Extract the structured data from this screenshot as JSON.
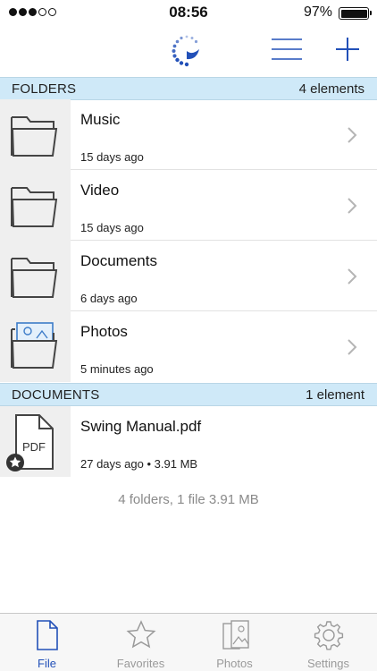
{
  "status_bar": {
    "time": "08:56",
    "battery_percent": "97%",
    "signal_bars_filled": 3,
    "signal_bars_total": 5
  },
  "navbar": {
    "logo_icon": "app-logo-icon",
    "menu_icon": "hamburger-menu-icon",
    "add_icon": "plus-icon",
    "accent_color": "#2250b8"
  },
  "folders_section": {
    "title": "FOLDERS",
    "count": "4 elements",
    "items": [
      {
        "name": "Music",
        "modified": "15 days ago",
        "icon": "folder-icon"
      },
      {
        "name": "Video",
        "modified": "15 days ago",
        "icon": "folder-icon"
      },
      {
        "name": "Documents",
        "modified": "6 days ago",
        "icon": "folder-icon"
      },
      {
        "name": "Photos",
        "modified": "5 minutes ago",
        "icon": "photos-folder-icon"
      }
    ]
  },
  "documents_section": {
    "title": "DOCUMENTS",
    "count": "1 element",
    "items": [
      {
        "name": "Swing Manual.pdf",
        "modified": "27 days ago",
        "separator": "•",
        "size": "3.91 MB",
        "icon": "pdf-file-icon",
        "badge": "PDF"
      }
    ]
  },
  "summary": "4 folders, 1 file 3.91 MB",
  "tabbar": {
    "tabs": [
      {
        "label": "File",
        "icon": "file-icon",
        "active": true
      },
      {
        "label": "Favorites",
        "icon": "star-icon",
        "active": false
      },
      {
        "label": "Photos",
        "icon": "photos-icon",
        "active": false
      },
      {
        "label": "Settings",
        "icon": "gear-icon",
        "active": false
      }
    ]
  },
  "colors": {
    "section_header_bg": "#cfe9f8",
    "active_tab": "#2250b8",
    "inactive_tab": "#9a9a9a"
  }
}
